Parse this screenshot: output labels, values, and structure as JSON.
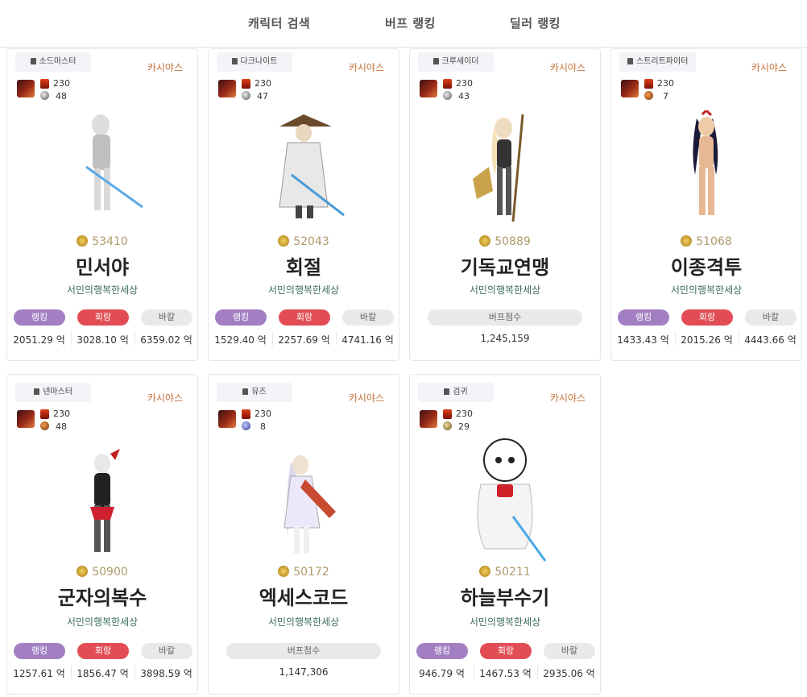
{
  "nav": {
    "search": "캐릭터 검색",
    "buff_ranking": "버프 랭킹",
    "dealer_ranking": "딜러 랭킹"
  },
  "labels": {
    "rank": "랭킹",
    "hwarang": "회랑",
    "bakal": "바칼",
    "buff_score": "버프점수"
  },
  "cards": [
    {
      "job": "소드마스터",
      "server": "카시야스",
      "level": "230",
      "sub": "48",
      "score": "53410",
      "name": "민서야",
      "guild": "서민의행복한세상",
      "type": "dealer",
      "rank": "2051.29 억",
      "hwarang": "3028.10 억",
      "bakal": "6359.02 억"
    },
    {
      "job": "다크나이트",
      "server": "카시야스",
      "level": "230",
      "sub": "47",
      "score": "52043",
      "name": "회절",
      "guild": "서민의행복한세상",
      "type": "dealer",
      "rank": "1529.40 억",
      "hwarang": "2257.69 억",
      "bakal": "4741.16 억"
    },
    {
      "job": "크루세이더",
      "server": "카시야스",
      "level": "230",
      "sub": "43",
      "score": "50889",
      "name": "기독교연맹",
      "guild": "서민의행복한세상",
      "type": "buffer",
      "buff": "1,245,159"
    },
    {
      "job": "스트리트파이터",
      "server": "카시야스",
      "level": "230",
      "sub": "7",
      "score": "51068",
      "name": "이종격투",
      "guild": "서민의행복한세상",
      "type": "dealer",
      "rank": "1433.43 억",
      "hwarang": "2015.26 억",
      "bakal": "4443.66 억"
    },
    {
      "job": "넨마스터",
      "server": "카시야스",
      "level": "230",
      "sub": "48",
      "score": "50900",
      "name": "군자의복수",
      "guild": "서민의행복한세상",
      "type": "dealer",
      "rank": "1257.61 억",
      "hwarang": "1856.47 억",
      "bakal": "3898.59 억"
    },
    {
      "job": "뮤즈",
      "server": "카시야스",
      "level": "230",
      "sub": "8",
      "score": "50172",
      "name": "엑세스코드",
      "guild": "서민의행복한세상",
      "type": "buffer",
      "buff": "1,147,306"
    },
    {
      "job": "검귀",
      "server": "카시야스",
      "level": "230",
      "sub": "29",
      "score": "50211",
      "name": "하늘부수기",
      "guild": "서민의행복한세상",
      "type": "dealer",
      "rank": "946.79 억",
      "hwarang": "1467.53 억",
      "bakal": "2935.06 억"
    }
  ]
}
